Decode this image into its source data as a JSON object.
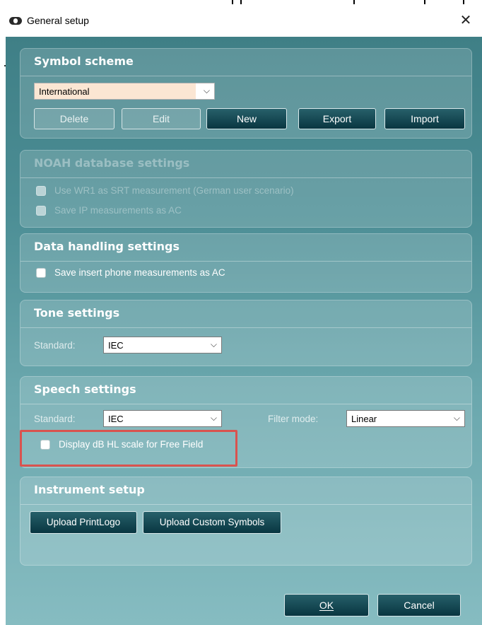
{
  "window": {
    "title": "General setup",
    "app_icon": "audiometer-icon",
    "close_icon": "close-icon"
  },
  "symbol_scheme": {
    "heading": "Symbol scheme",
    "selected": "International",
    "buttons": {
      "delete": "Delete",
      "edit": "Edit",
      "new": "New",
      "export": "Export",
      "import": "Import"
    }
  },
  "noah": {
    "heading": "NOAH database settings",
    "options": [
      {
        "label": "Use WR1 as SRT measurement (German user scenario)",
        "checked": false
      },
      {
        "label": "Save IP measurements as AC",
        "checked": false
      }
    ]
  },
  "data_handling": {
    "heading": "Data handling settings",
    "option": {
      "label": "Save insert phone measurements as AC",
      "checked": false
    }
  },
  "tone": {
    "heading": "Tone settings",
    "standard_label": "Standard:",
    "standard_value": "IEC"
  },
  "speech": {
    "heading": "Speech settings",
    "standard_label": "Standard:",
    "standard_value": "IEC",
    "filter_label": "Filter mode:",
    "filter_value": "Linear",
    "free_field_option": {
      "label": "Display dB HL scale for Free Field",
      "checked": false
    }
  },
  "instrument": {
    "heading": "Instrument setup",
    "upload_logo": "Upload PrintLogo",
    "upload_symbols": "Upload Custom Symbols"
  },
  "footer": {
    "ok": "OK",
    "cancel": "Cancel"
  },
  "colors": {
    "accent_button": "#0e3f49",
    "panel_bg": "#4c8e95",
    "highlight_box": "#d9534f",
    "scheme_dropdown_bg": "#fbe6d3"
  }
}
